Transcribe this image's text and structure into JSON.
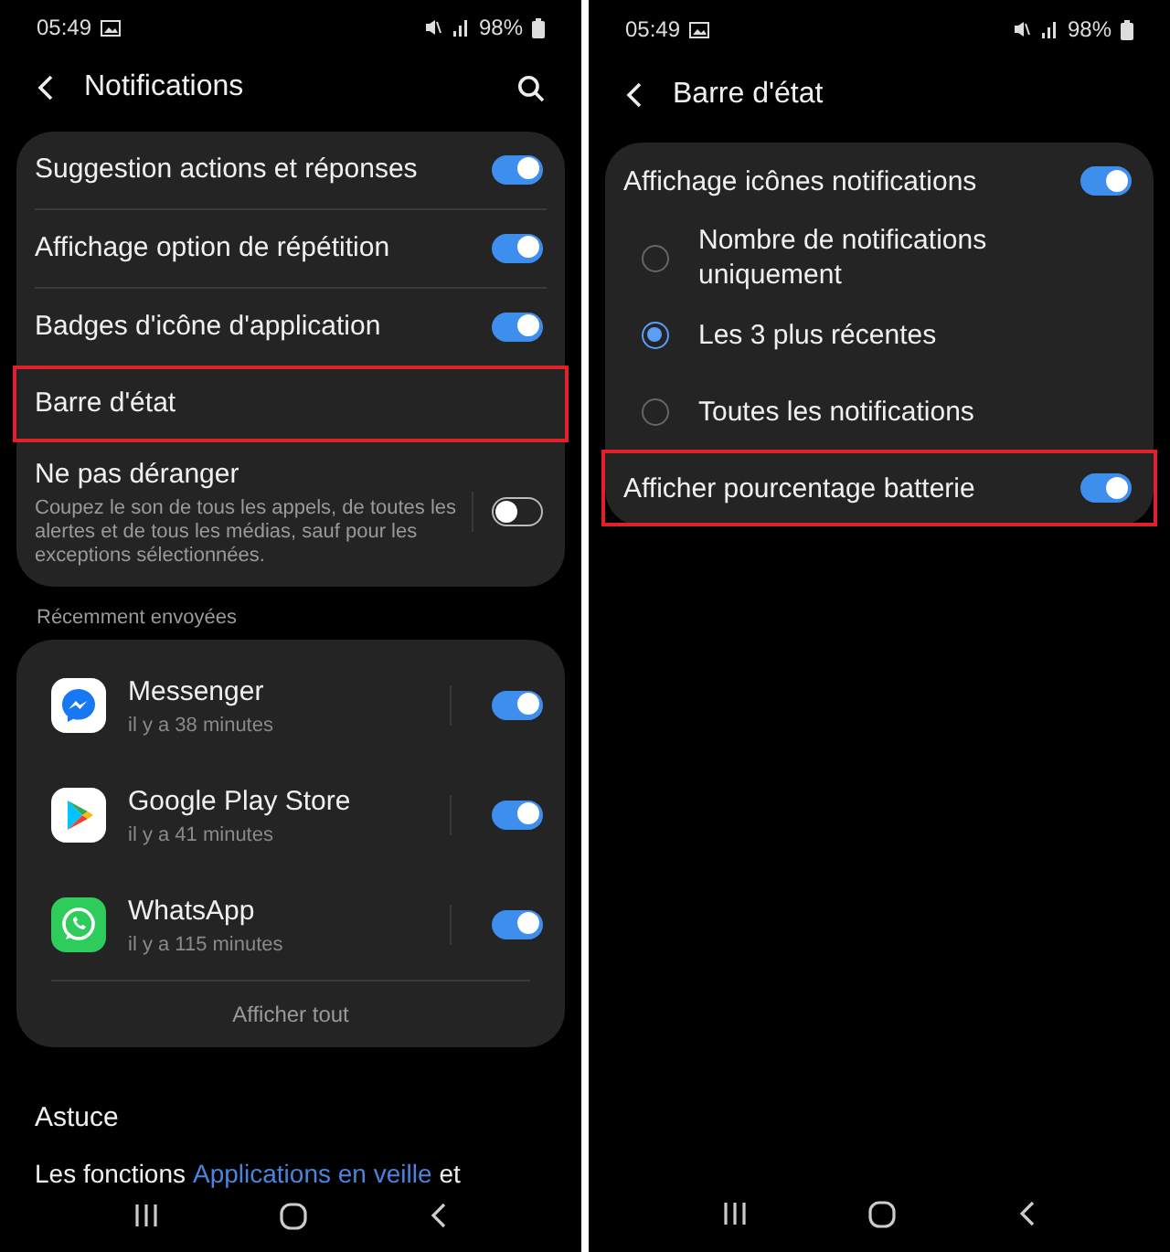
{
  "screens": [
    {
      "status_bar": {
        "time": "05:49",
        "battery": "98%"
      },
      "header": {
        "title": "Notifications",
        "has_search": true
      },
      "settings": [
        {
          "kind": "toggle",
          "label": "Suggestion actions et réponses",
          "on": true,
          "highlighted": false
        },
        {
          "kind": "toggle",
          "label": "Affichage option de répétition",
          "on": true,
          "highlighted": false
        },
        {
          "kind": "toggle",
          "label": "Badges d'icône d'application",
          "on": true,
          "highlighted": false
        },
        {
          "kind": "link",
          "label": "Barre d'état",
          "highlighted": true
        },
        {
          "kind": "toggle",
          "label": "Ne pas déranger",
          "description": "Coupez le son de tous les appels, de toutes les alertes et de tous les médias, sauf pour les exceptions sélectionnées.",
          "on": false,
          "highlighted": false
        }
      ],
      "recent": {
        "title": "Récemment envoyées",
        "apps": [
          {
            "kind": "messenger",
            "name": "Messenger",
            "time": "il y a 38 minutes",
            "on": true
          },
          {
            "kind": "play",
            "name": "Google Play Store",
            "time": "il y a 41 minutes",
            "on": true
          },
          {
            "kind": "whatsapp",
            "name": "WhatsApp",
            "time": "il y a 115 minutes",
            "on": true
          }
        ],
        "show_all": "Afficher tout"
      },
      "tip": {
        "title": "Astuce",
        "text_before": "Les fonctions",
        "link": "Applications en veille",
        "text_after": "et"
      }
    },
    {
      "status_bar": {
        "time": "05:49",
        "battery": "98%"
      },
      "header": {
        "title": "Barre d'état",
        "has_search": false
      },
      "settings": [
        {
          "kind": "toggle",
          "label": "Affichage icônes notifications",
          "on": true,
          "highlighted": false
        },
        {
          "kind": "radio",
          "label": "Nombre de notifications uniquement",
          "selected": false,
          "highlighted": false
        },
        {
          "kind": "radio",
          "label": "Les 3 plus récentes",
          "selected": true,
          "highlighted": false
        },
        {
          "kind": "radio",
          "label": "Toutes les notifications",
          "selected": false,
          "highlighted": false
        },
        {
          "kind": "toggle",
          "label": "Afficher pourcentage batterie",
          "on": true,
          "highlighted": true
        }
      ]
    }
  ]
}
